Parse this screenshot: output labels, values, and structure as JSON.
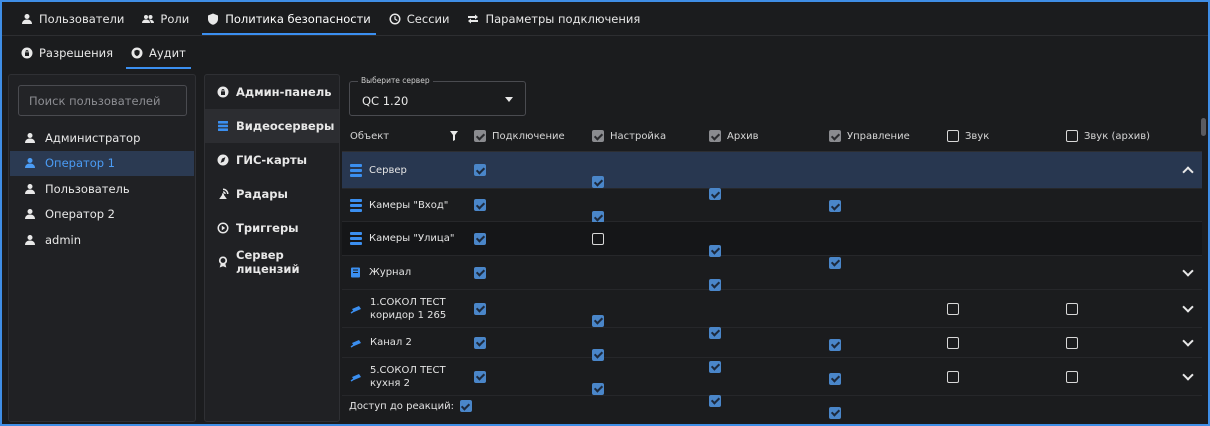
{
  "top_tabs": [
    {
      "label": "Пользователи",
      "icon": "user-icon",
      "active": false
    },
    {
      "label": "Роли",
      "icon": "users-group-icon",
      "active": false
    },
    {
      "label": "Политика безопасности",
      "icon": "shield-icon",
      "active": true
    },
    {
      "label": "Сессии",
      "icon": "clock-icon",
      "active": false
    },
    {
      "label": "Параметры подключения",
      "icon": "connection-settings-icon",
      "active": false
    }
  ],
  "sub_tabs": [
    {
      "label": "Разрешения",
      "icon": "lock-icon",
      "active": false
    },
    {
      "label": "Аудит",
      "icon": "audit-shield-icon",
      "active": true
    }
  ],
  "users": {
    "search_placeholder": "Поиск пользователей",
    "items": [
      {
        "label": "Администратор",
        "selected": false
      },
      {
        "label": "Оператор 1",
        "selected": true
      },
      {
        "label": "Пользователь",
        "selected": false
      },
      {
        "label": "Оператор 2",
        "selected": false
      },
      {
        "label": "admin",
        "selected": false
      }
    ]
  },
  "categories": [
    {
      "label": "Админ-панель",
      "icon": "lock-icon",
      "active": false
    },
    {
      "label": "Видеосерверы",
      "icon": "server-icon",
      "active": true
    },
    {
      "label": "ГИС-карты",
      "icon": "map-icon",
      "active": false
    },
    {
      "label": "Радары",
      "icon": "radar-icon",
      "active": false
    },
    {
      "label": "Триггеры",
      "icon": "trigger-icon",
      "active": false
    },
    {
      "label": "Сервер лицензий",
      "icon": "license-icon",
      "active": false
    }
  ],
  "server_select": {
    "legend": "Выберите сервер",
    "value": "QC 1.20"
  },
  "grid": {
    "object_header": "Объект",
    "columns": [
      {
        "label": "Подключение",
        "checked": true
      },
      {
        "label": "Настройка",
        "checked": true
      },
      {
        "label": "Архив",
        "checked": true
      },
      {
        "label": "Управление",
        "checked": true
      },
      {
        "label": "Звук",
        "checked": false
      },
      {
        "label": "Звук (архив)",
        "checked": false
      }
    ],
    "rows": [
      {
        "line1": "Сервер",
        "line2": "",
        "icon": "server-icon",
        "values": [
          true,
          true,
          true,
          true,
          null,
          null
        ],
        "expander": "collapse"
      },
      {
        "line1": "Камеры \"Вход\"",
        "line2": "",
        "icon": "server-icon",
        "values": [
          true,
          true,
          true,
          true,
          null,
          null
        ],
        "expander": "none"
      },
      {
        "line1": "Камеры \"Улица\"",
        "line2": "",
        "icon": "server-icon",
        "values": [
          true,
          false,
          true,
          true,
          null,
          null
        ],
        "expander": "none"
      },
      {
        "line1": "Журнал",
        "line2": "",
        "icon": "journal-icon",
        "values": [
          true,
          null,
          true,
          null,
          null,
          null
        ],
        "expander": "expand"
      },
      {
        "line1": "1.СОКОЛ ТЕСТ",
        "line2": "коридор 1 265",
        "icon": "camera-icon",
        "values": [
          true,
          true,
          true,
          true,
          false,
          false
        ],
        "expander": "expand"
      },
      {
        "line1": "Канал 2",
        "line2": "",
        "icon": "camera-icon",
        "values": [
          true,
          true,
          true,
          true,
          false,
          false
        ],
        "expander": "expand"
      },
      {
        "line1": "5.СОКОЛ ТЕСТ",
        "line2": "кухня 2",
        "icon": "camera-icon",
        "values": [
          true,
          true,
          true,
          true,
          false,
          false
        ],
        "expander": "expand"
      }
    ]
  },
  "footer": {
    "label": "Доступ до реакций:",
    "checked": true
  },
  "colors": {
    "accent": "#3b8ff0",
    "selected_row": "#283750",
    "checkbox_on": "#4a86c9"
  }
}
